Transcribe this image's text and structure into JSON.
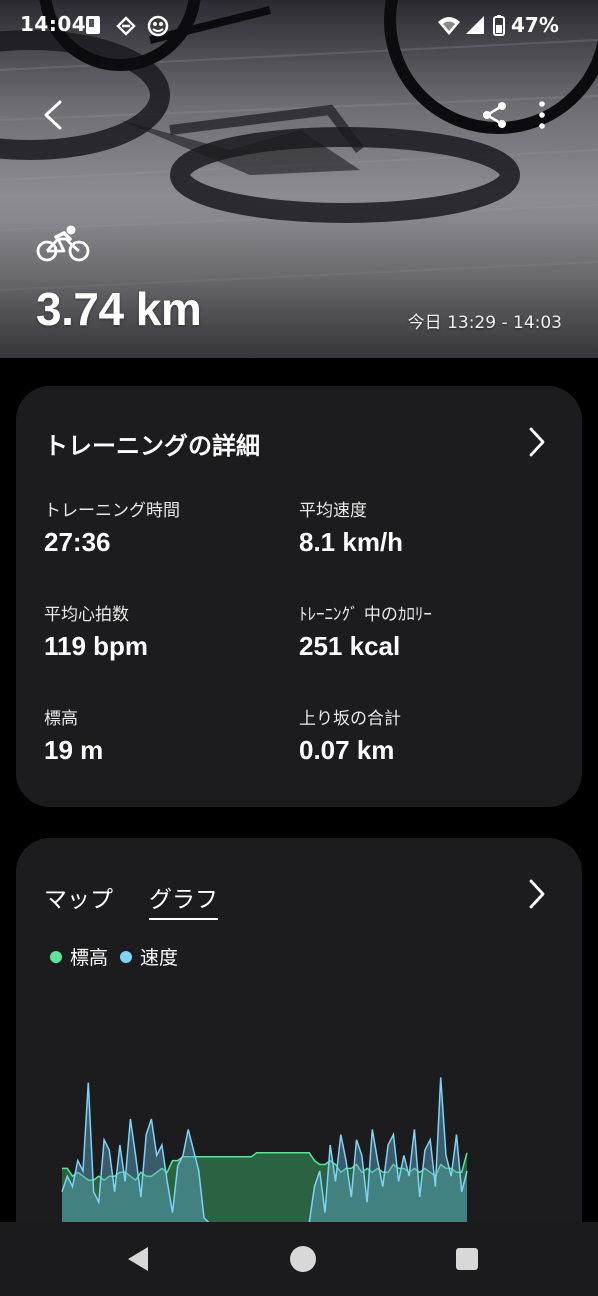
{
  "status_bar": {
    "time": "14:04",
    "battery": "47%"
  },
  "hero": {
    "sport_icon": "cycling-icon",
    "distance": "3.74 km",
    "datetime": "今日 13:29 - 14:03"
  },
  "details": {
    "title": "トレーニングの詳細",
    "metrics": [
      {
        "label": "トレーニング時間",
        "value": "27:36"
      },
      {
        "label": "平均速度",
        "value": "8.1 km/h"
      },
      {
        "label": "平均心拍数",
        "value": "119 bpm"
      },
      {
        "label": "ﾄﾚｰﾆﾝｸﾞ 中のｶﾛﾘｰ",
        "value": "251 kcal"
      },
      {
        "label": "標高",
        "value": "19 m"
      },
      {
        "label": "上り坂の合計",
        "value": "0.07 km"
      }
    ]
  },
  "graph_card": {
    "tabs": [
      "マップ",
      "グラフ"
    ],
    "active_tab": "グラフ",
    "legend": [
      {
        "label": "標高",
        "color": "#5fe39c"
      },
      {
        "label": "速度",
        "color": "#7fd3f5"
      }
    ]
  },
  "chart_data": {
    "type": "area",
    "series": [
      {
        "name": "標高",
        "color": "#5fe39c",
        "values": [
          14,
          14,
          12,
          13,
          12,
          11,
          11,
          12,
          11,
          12,
          12,
          13,
          13,
          12,
          11,
          13,
          12,
          12,
          13,
          14,
          13,
          16,
          16,
          17,
          17,
          17,
          17,
          17,
          17,
          17,
          17,
          17,
          17,
          17,
          17,
          17,
          17,
          18,
          18,
          18,
          18,
          18,
          18,
          18,
          18,
          18,
          18,
          18,
          16,
          15,
          15,
          16,
          15,
          13,
          14,
          14,
          15,
          13,
          14,
          13,
          14,
          13,
          13,
          15,
          14,
          14,
          13,
          14,
          13,
          14,
          13,
          12,
          15,
          14,
          14,
          13,
          13,
          18
        ]
      },
      {
        "name": "速度",
        "color": "#7fd3f5",
        "values": [
          6,
          9,
          7,
          12,
          10,
          27,
          6,
          4,
          16,
          14,
          6,
          15,
          8,
          20,
          13,
          5,
          17,
          20,
          13,
          15,
          8,
          2,
          11,
          13,
          18,
          14,
          10,
          1,
          0,
          0,
          0,
          0,
          0,
          0,
          0,
          0,
          0,
          0,
          0,
          0,
          0,
          0,
          0,
          0,
          0,
          0,
          0,
          0,
          7,
          10,
          2,
          15,
          8,
          17,
          12,
          5,
          16,
          13,
          4,
          18,
          12,
          7,
          15,
          17,
          8,
          13,
          9,
          18,
          5,
          14,
          16,
          7,
          28,
          13,
          9,
          17,
          6,
          10
        ]
      }
    ]
  }
}
